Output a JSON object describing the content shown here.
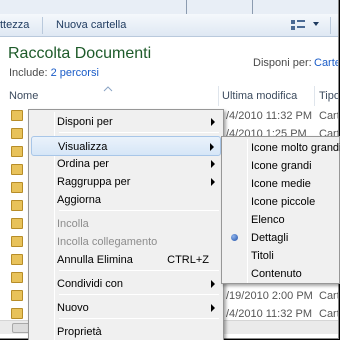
{
  "toolbar": {
    "left_item": "ttezza",
    "new_folder": "Nuova cartella"
  },
  "library": {
    "title": "Raccolta Documenti",
    "include_label": "Include:",
    "include_link": "2 percorsi",
    "arrange_label": "Disponi per:",
    "arrange_value": "Carte"
  },
  "columns": {
    "name": "Nome",
    "modified": "Ultima modifica",
    "type": "Tipo"
  },
  "rows": [
    {
      "date": "/4/2010 11:32 PM",
      "type": "Carte"
    },
    {
      "date": "/4/2010 1:25 PM",
      "type": "Carte"
    },
    {
      "date": "",
      "type": ""
    },
    {
      "date": "",
      "type": ""
    },
    {
      "date": "",
      "type": ""
    },
    {
      "date": "",
      "type": ""
    },
    {
      "date": "",
      "type": ""
    },
    {
      "date": "",
      "type": ""
    },
    {
      "date": "",
      "type": ""
    },
    {
      "date": "",
      "type": ""
    },
    {
      "date": "/19/2010 2:00 PM",
      "type": "Carte"
    },
    {
      "date": "/4/2010 11:32 PM",
      "type": "Carte"
    }
  ],
  "context_menu": {
    "items": [
      {
        "label": "Disponi per",
        "submenu": true
      },
      {
        "label": "Visualizza",
        "submenu": true,
        "highlighted": true
      },
      {
        "label": "Ordina per",
        "submenu": true
      },
      {
        "label": "Raggruppa per",
        "submenu": true
      },
      {
        "label": "Aggiorna"
      },
      {
        "label": "Incolla",
        "disabled": true
      },
      {
        "label": "Incolla collegamento",
        "disabled": true
      },
      {
        "label": "Annulla Elimina",
        "shortcut": "CTRL+Z"
      },
      {
        "label": "Condividi con",
        "submenu": true
      },
      {
        "label": "Nuovo",
        "submenu": true
      },
      {
        "label": "Proprietà"
      }
    ]
  },
  "view_submenu": {
    "items": [
      {
        "label": "Icone molto grandi"
      },
      {
        "label": "Icone grandi"
      },
      {
        "label": "Icone medie"
      },
      {
        "label": "Icone piccole"
      },
      {
        "label": "Elenco"
      },
      {
        "label": "Dettagli",
        "selected": true
      },
      {
        "label": "Titoli"
      },
      {
        "label": "Contenuto"
      }
    ]
  },
  "colors": {
    "title_green": "#1e5b2a",
    "link_blue": "#1a5cc8",
    "highlight": "#d6e6f7",
    "selected_dot": "#1f4fa8"
  }
}
